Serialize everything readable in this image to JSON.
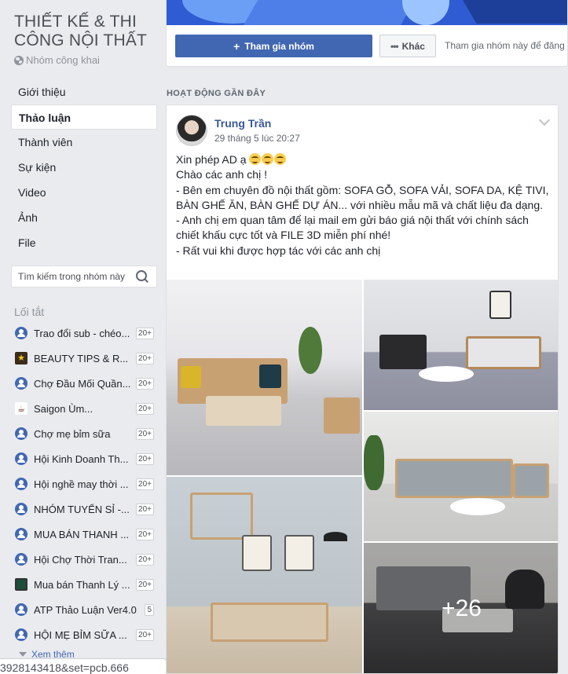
{
  "group": {
    "title": "THIẾT KẾ & THI CÔNG NỘI THẤT",
    "privacy": "Nhóm công khai"
  },
  "nav": {
    "items": [
      {
        "label": "Giới thiệu",
        "active": false
      },
      {
        "label": "Thảo luận",
        "active": true
      },
      {
        "label": "Thành viên",
        "active": false
      },
      {
        "label": "Sự kiện",
        "active": false
      },
      {
        "label": "Video",
        "active": false
      },
      {
        "label": "Ảnh",
        "active": false
      },
      {
        "label": "File",
        "active": false
      }
    ]
  },
  "search": {
    "placeholder": "Tìm kiếm trong nhóm này"
  },
  "shortcuts": {
    "title": "Lối tắt",
    "items": [
      {
        "label": "Trao đổi sub - chéo...",
        "badge": "20+",
        "icon": "group-icon"
      },
      {
        "label": "BEAUTY TIPS & R...",
        "badge": "20+",
        "icon": "star-image-icon"
      },
      {
        "label": "Chợ Đầu Mối Quần...",
        "badge": "20+",
        "icon": "group-icon"
      },
      {
        "label": "Saigon Ùm...",
        "badge": "20+",
        "icon": "coffee-image-icon"
      },
      {
        "label": "Chợ mẹ bỉm sữa",
        "badge": "20+",
        "icon": "group-icon"
      },
      {
        "label": "Hội Kinh Doanh Th...",
        "badge": "20+",
        "icon": "group-icon"
      },
      {
        "label": "Hội nghề may thời ...",
        "badge": "20+",
        "icon": "group-icon"
      },
      {
        "label": "NHÓM TUYỂN SỈ -...",
        "badge": "20+",
        "icon": "group-icon"
      },
      {
        "label": "MUA BÁN THANH ...",
        "badge": "20+",
        "icon": "group-icon"
      },
      {
        "label": "Hội Chợ Thời Tran...",
        "badge": "20+",
        "icon": "group-icon"
      },
      {
        "label": "Mua bán Thanh Lý ...",
        "badge": "20+",
        "icon": "dark-image-icon"
      },
      {
        "label": "ATP Thảo Luận Ver4.0",
        "badge": "5",
        "icon": "group-icon"
      },
      {
        "label": "HỘI MẸ BỈM SỮA ...",
        "badge": "20+",
        "icon": "group-icon"
      }
    ],
    "see_more": "Xem thêm"
  },
  "statusbar": {
    "text": "3928143418&set=pcb.666"
  },
  "header": {
    "join_label": "Tham gia nhóm",
    "more_label": "Khác",
    "join_hint": "Tham gia nhóm này để đăng v"
  },
  "recent_activity": {
    "title": "HOẠT ĐỘNG GẦN ĐÂY"
  },
  "post": {
    "author": "Trung Trần",
    "time": "29 tháng 5 lúc 20:27",
    "lines": [
      "Xin phép AD ạ",
      "Chào các anh chị !",
      "- Bên em chuyên đồ nội thất gồm: SOFA GỖ, SOFA VẢI, SOFA DA, KỆ TIVI, BÀN GHẾ ĂN, BÀN GHẾ DỰ ÁN... với nhiều mẫu mã và chất liệu đa dạng.",
      "- Anh chị em quan tâm để lại mail em gửi báo giá nội thất với chính sách chiết khấu cực tốt và FILE 3D miễn phí nhé!",
      "- Rất vui khi được hợp tác với các anh chị"
    ],
    "emoji_count": 3,
    "more_photos": "+26"
  },
  "colors": {
    "brand": "#4267b2",
    "link": "#385898",
    "background": "#e9ebee"
  }
}
